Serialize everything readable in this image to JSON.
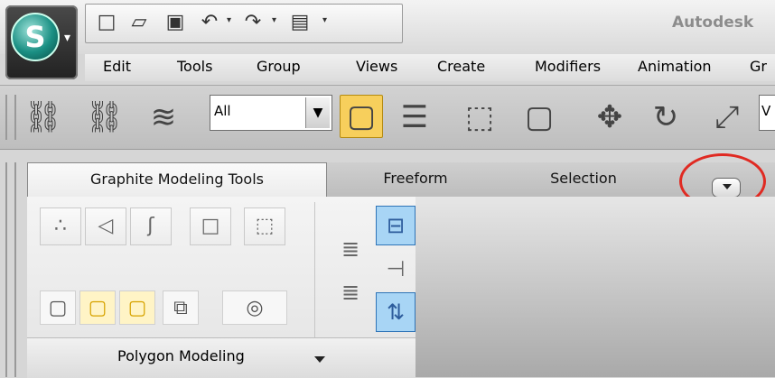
{
  "app": {
    "title": "Autodesk",
    "logo_letter": "S"
  },
  "quick_access": {
    "icons": [
      "new-file-icon",
      "open-folder-icon",
      "save-icon",
      "undo-icon",
      "redo-icon",
      "project-folder-icon",
      "customize-qat-icon"
    ],
    "glyphs": [
      "□",
      "▱",
      "▣",
      "↶",
      "↷",
      "▤",
      "▾"
    ]
  },
  "menu": {
    "items": [
      "Edit",
      "Tools",
      "Group",
      "Views",
      "Create",
      "Modifiers",
      "Animation",
      "Gr"
    ]
  },
  "toolbar": {
    "selection_filter_value": "All",
    "edge_field_value": "V",
    "glyphs": {
      "link": "⛓",
      "unlink": "⛓",
      "bind": "≋",
      "select": "▢",
      "select_by_name": "☰",
      "rect_region": "⬚",
      "window_crossing": "▢",
      "move": "✥",
      "rotate": "↻",
      "scale": "⤢"
    }
  },
  "ribbon": {
    "tabs": [
      "Graphite Modeling Tools",
      "Freeform",
      "Selection"
    ],
    "active_tab": "Graphite Modeling Tools",
    "panel_title": "Polygon Modeling",
    "highlight_color": "#e02a22",
    "active_color": "#f7cf5c"
  }
}
